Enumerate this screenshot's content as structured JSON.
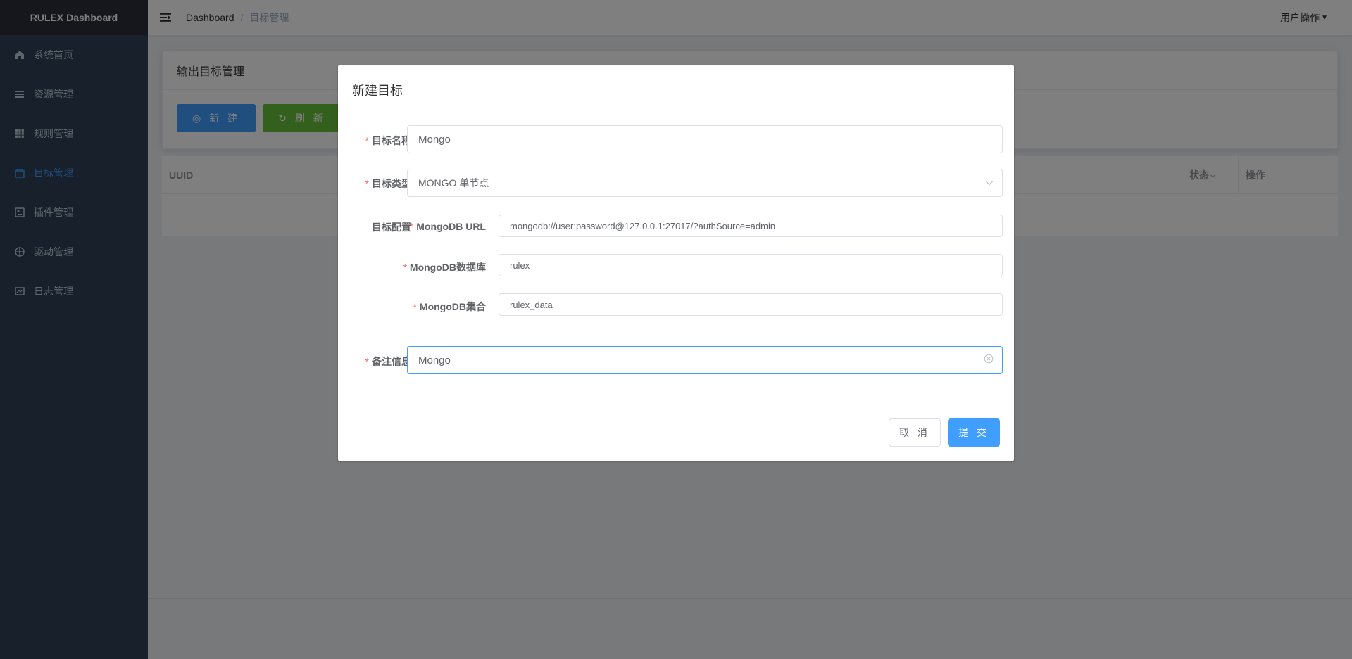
{
  "brand": {
    "title": "RULEX Dashboard"
  },
  "sidebar": {
    "items": [
      {
        "label": "系统首页",
        "icon": "home-icon"
      },
      {
        "label": "资源管理",
        "icon": "list-icon"
      },
      {
        "label": "规则管理",
        "icon": "grid-icon"
      },
      {
        "label": "目标管理",
        "icon": "target-icon",
        "active": true
      },
      {
        "label": "插件管理",
        "icon": "plugin-icon"
      },
      {
        "label": "驱动管理",
        "icon": "driver-icon"
      },
      {
        "label": "日志管理",
        "icon": "log-icon"
      }
    ]
  },
  "navbar": {
    "breadcrumb": [
      "Dashboard",
      "目标管理"
    ],
    "user_menu": "用户操作"
  },
  "page": {
    "card_title": "输出目标管理",
    "new_button": "新 建",
    "refresh_button": "刷 新",
    "table": {
      "columns": [
        "UUID",
        "状态",
        "操作"
      ]
    }
  },
  "dialog": {
    "title": "新建目标",
    "fields": {
      "name": {
        "label": "目标名称",
        "value": "Mongo"
      },
      "type": {
        "label": "目标类型",
        "value": "MONGO 单节点"
      },
      "config": {
        "label": "目标配置"
      },
      "mongo_url": {
        "label": "MongoDB URL",
        "value": "mongodb://user:password@127.0.0.1:27017/?authSource=admin"
      },
      "mongo_db": {
        "label": "MongoDB数据库",
        "value": "rulex"
      },
      "mongo_collection": {
        "label": "MongoDB集合",
        "value": "rulex_data"
      },
      "description": {
        "label": "备注信息",
        "value": "Mongo"
      }
    },
    "cancel_button": "取 消",
    "submit_button": "提 交"
  },
  "colors": {
    "sidebar_bg": "#304156",
    "brand_bg": "#2b2f3a",
    "primary": "#409eff",
    "success": "#67c23a",
    "required": "#f56c6c",
    "overlay": "rgba(0,0,0,0.5)"
  }
}
